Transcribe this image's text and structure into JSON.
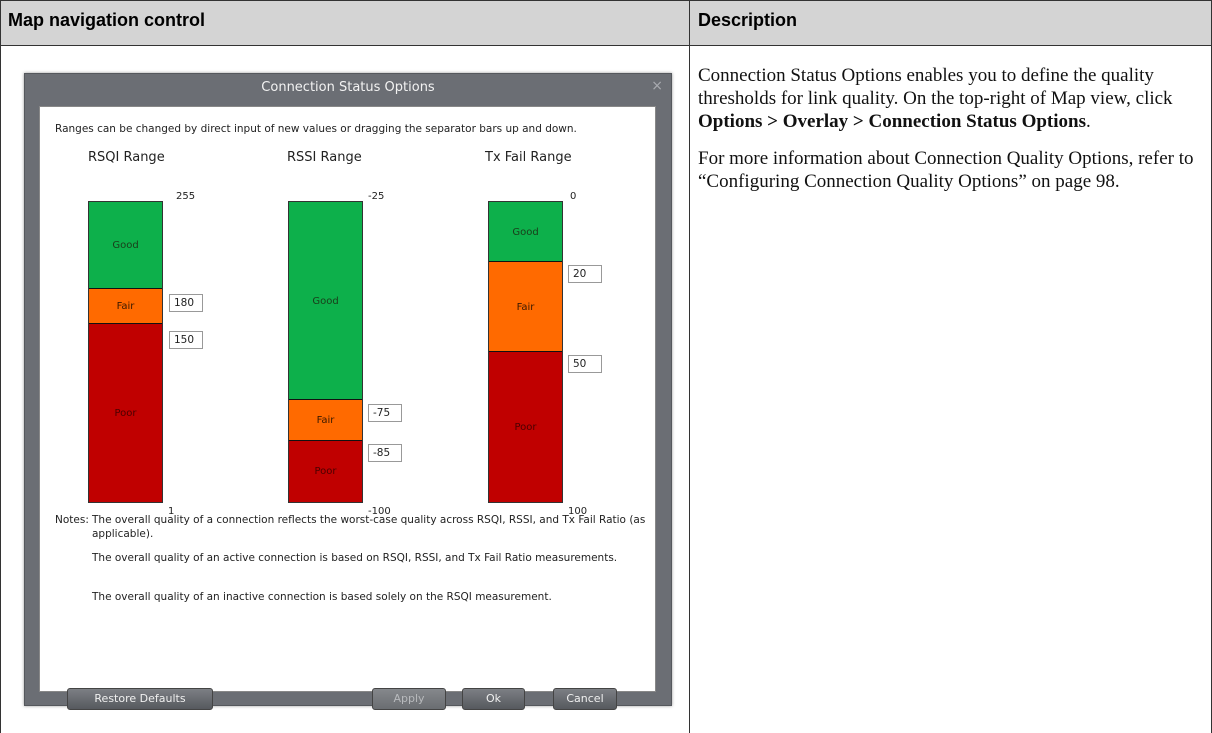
{
  "table": {
    "col1_header": "Map navigation control",
    "col2_header": "Description"
  },
  "description": {
    "p1_text": "Connection Status Options enables you to define the quality thresholds for link quality. On the top-right of Map view, click ",
    "p1_bold": "Options > Overlay > Connection Status Options",
    "p1_end": ".",
    "p2": "For more information about Connection Quality Options, refer to “Configuring Connection Quality Options” on page 98."
  },
  "dialog": {
    "title": "Connection Status Options",
    "close": "×",
    "intro": "Ranges can be changed by direct input of new values or dragging the separator bars up and down.",
    "ranges": [
      {
        "title": "RSQI Range",
        "top_label": "255",
        "bottom_label": "1",
        "segments": [
          {
            "label": "Good",
            "fraction": 0.29
          },
          {
            "label": "Fair",
            "fraction": 0.117
          },
          {
            "label": "Poor",
            "fraction": 0.593
          }
        ],
        "inputs": [
          "180",
          "150"
        ]
      },
      {
        "title": "RSSI Range",
        "top_label": "-25",
        "bottom_label": "-100",
        "segments": [
          {
            "label": "Good",
            "fraction": 0.66
          },
          {
            "label": "Fair",
            "fraction": 0.136
          },
          {
            "label": "Poor",
            "fraction": 0.204
          }
        ],
        "inputs": [
          "-75",
          "-85"
        ]
      },
      {
        "title": "Tx Fail Range",
        "top_label": "0",
        "bottom_label": "100",
        "segments": [
          {
            "label": "Good",
            "fraction": 0.2
          },
          {
            "label": "Fair",
            "fraction": 0.3
          },
          {
            "label": "Poor",
            "fraction": 0.5
          }
        ],
        "inputs": [
          "20",
          "50"
        ]
      }
    ],
    "notes_label": "Notes:",
    "notes": [
      "The overall quality of a connection reflects the worst-case quality across RSQI, RSSI, and Tx Fail Ratio (as applicable).",
      "The overall quality of an active connection is based on RSQI, RSSI, and Tx Fail Ratio measurements.",
      "The overall quality of an inactive connection is based solely on the RSQI measurement."
    ],
    "buttons": {
      "restore": "Restore Defaults",
      "apply": "Apply",
      "ok": "Ok",
      "cancel": "Cancel"
    }
  },
  "colors": {
    "good": "#0db04b",
    "fair": "#ff6a00",
    "poor": "#c00000"
  }
}
